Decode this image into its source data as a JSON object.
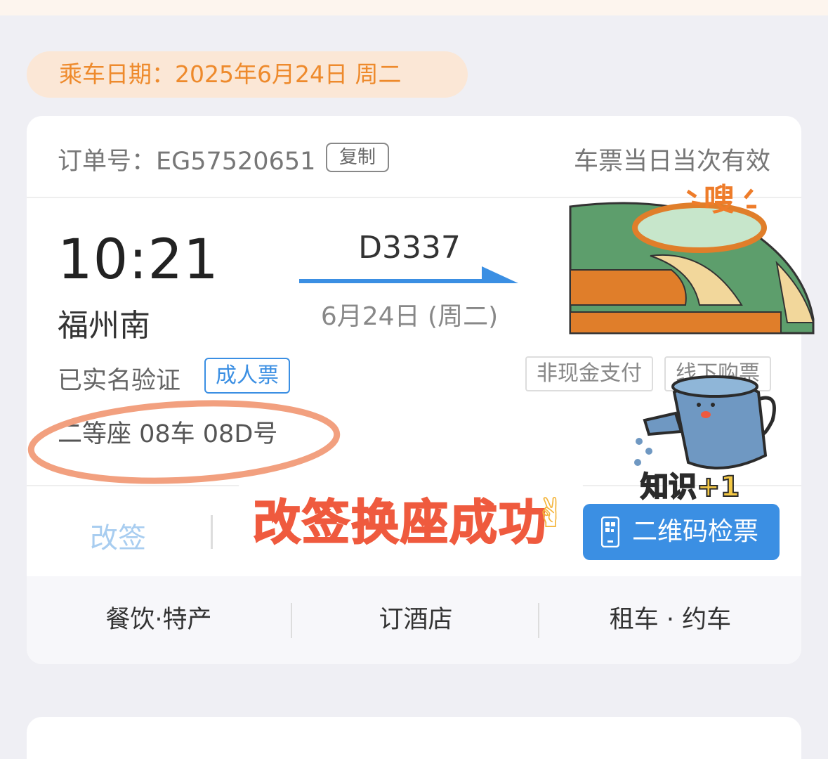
{
  "travel_date_banner": "乘车日期：2025年6月24日 周二",
  "order": {
    "order_no_text": "订单号：EG57520651",
    "copy_label": "复制",
    "validity": "车票当日当次有效"
  },
  "trip": {
    "departure_time": "10:21",
    "departure_station": "福州南",
    "train_no": "D3337",
    "date": "6月24日 (周二)"
  },
  "passenger": {
    "verified": "已实名验证",
    "ticket_type": "成人票",
    "seat": "二等座 08车 08D号",
    "tags": [
      "非现金支付",
      "线下购票"
    ]
  },
  "actions": {
    "change_label": "改签",
    "qr_label": "二维码检票"
  },
  "services": [
    "餐饮·特产",
    "订酒店",
    "租车 · 约车"
  ],
  "stickers": {
    "main": "改签换座成功",
    "emoji": "✌",
    "knowledge": "知识+1",
    "whoosh": "嗖"
  },
  "colors": {
    "accent_blue": "#3b8fe3",
    "date_orange": "#ee8a2c",
    "highlight_circle": "#f2a07f",
    "sticker_red": "#ef5a3e"
  }
}
